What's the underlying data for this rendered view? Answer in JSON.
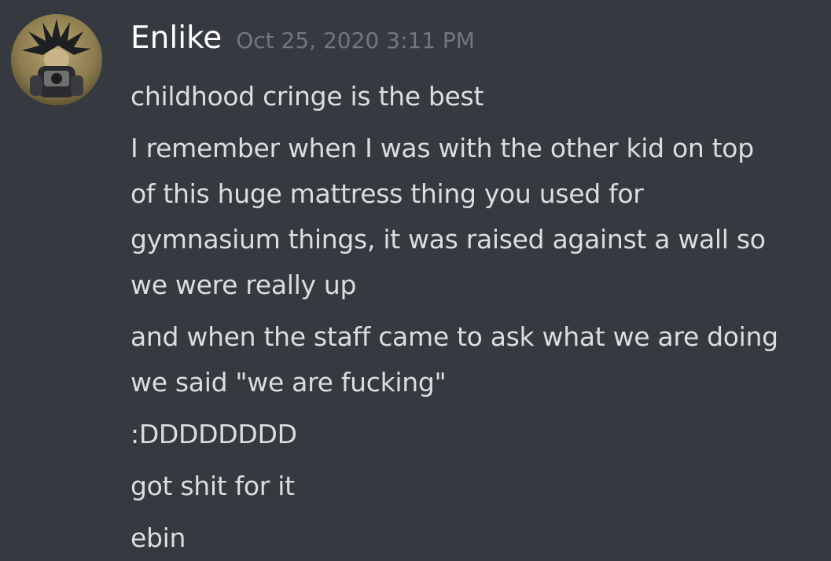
{
  "message": {
    "author": "Enlike",
    "timestamp": "Oct 25, 2020 3:11 PM",
    "avatar_icon": "user-avatar-image",
    "lines": [
      "childhood cringe is the best",
      "I remember when I was with the other kid on top",
      "of this huge mattress thing you used for",
      "gymnasium things, it was raised against a wall so",
      "we were really up",
      "and when the staff came to ask what we are doing",
      "we said \"we are fucking\"",
      ":DDDDDDDD",
      "got shit for it",
      "ebin"
    ]
  },
  "colors": {
    "background": "#36393f",
    "username": "#ffffff",
    "timestamp": "#72767d",
    "text": "#dcddde"
  }
}
